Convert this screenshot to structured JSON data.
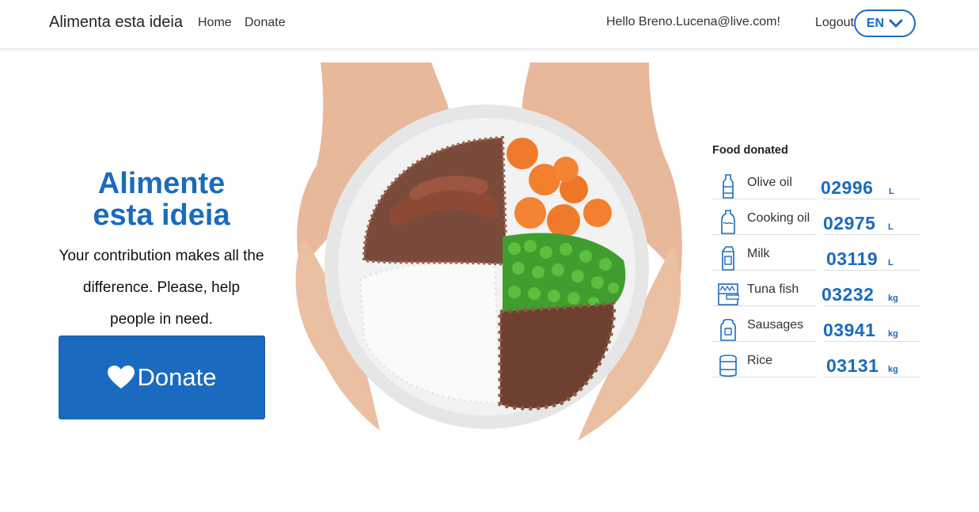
{
  "navbar": {
    "brand": "Alimenta esta ideia",
    "links": [
      "Home",
      "Donate"
    ],
    "greeting": "Hello Breno.Lucena@live.com!",
    "logout": "Logout",
    "language": "EN"
  },
  "hero": {
    "title_line1": "Alimente",
    "title_line2": "esta ideia",
    "text": "Your contribution makes all the difference. Please, help people in need.",
    "donate_label": "Donate",
    "donate_icon": "heart-icon"
  },
  "image": {
    "alt": "hands-holding-plate-of-food"
  },
  "food": {
    "title": "Food donated",
    "items": [
      {
        "name": "Olive oil",
        "value": "02996",
        "unit": "L",
        "icon": "olive-oil-bottle-icon"
      },
      {
        "name": "Cooking oil",
        "value": "02975",
        "unit": "L",
        "icon": "cooking-oil-bottle-icon"
      },
      {
        "name": "Milk",
        "value": "03119",
        "unit": "L",
        "icon": "milk-carton-icon"
      },
      {
        "name": "Tuna fish",
        "value": "03232",
        "unit": "kg",
        "icon": "tuna-can-icon"
      },
      {
        "name": "Sausages",
        "value": "03941",
        "unit": "kg",
        "icon": "sausage-package-icon"
      },
      {
        "name": "Rice",
        "value": "03131",
        "unit": "kg",
        "icon": "rice-package-icon"
      }
    ]
  },
  "colors": {
    "primary": "#1a6bbf",
    "text": "#212529"
  }
}
